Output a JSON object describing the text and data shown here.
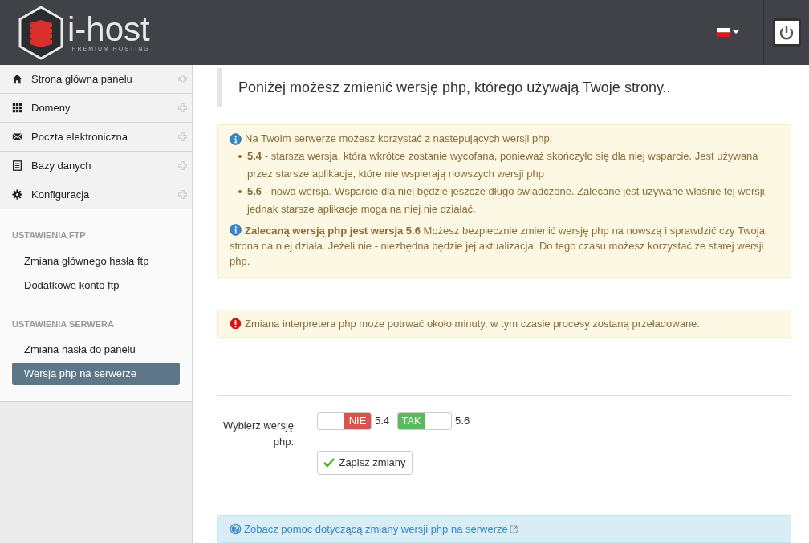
{
  "header": {
    "logo_text": "i-host",
    "logo_tagline": "PREMIUM HOSTING"
  },
  "sidebar": {
    "menu": [
      {
        "label": "Strona główna panelu"
      },
      {
        "label": "Domeny"
      },
      {
        "label": "Poczta elektroniczna"
      },
      {
        "label": "Bazy danych"
      },
      {
        "label": "Konfiguracja"
      }
    ],
    "sections": [
      {
        "heading": "USTAWIENIA FTP",
        "items": [
          {
            "label": "Zmiana głównego hasła ftp",
            "selected": false
          },
          {
            "label": "Dodatkowe konto ftp",
            "selected": false
          }
        ]
      },
      {
        "heading": "USTAWIENIA SERWERA",
        "items": [
          {
            "label": "Zmiana hasła do panelu",
            "selected": false
          },
          {
            "label": "Wersja php na serwerze",
            "selected": true
          }
        ]
      }
    ]
  },
  "page_title": "Poniżej możesz zmienić wersję php, którego używają Twoje strony..",
  "info": {
    "intro": "Na Twoim serwerze możesz korzystać z nastepujących wersji php:",
    "bullets": [
      "**5.4** - starsza wersja, która wkrótce zostanie wycofana, ponieważ skończyło się dla niej wsparcie. Jest używana przez starsze aplikacje, które nie wspierają nowszych wersji php",
      "**5.6** - nowa wersja. Wsparcie dla niej będzie jeszcze długo świadczone. Zalecane jest używane właśnie tej wersji, jednak starsze aplikacje moga na niej nie działać."
    ],
    "recommendation": "**Zalecaną wersją php jest wersja 5.6** Możesz bezpiecznie zmienić wersję php na nowszą i sprawdzić czy Twoja strona na niej działa. Jeżeli nie - niezbędna będzie jej aktualizacja. Do tego czasu możesz korzystać ze starej wersji php."
  },
  "warning": "Zmiana interpretera php może potrwać około minuty, w tym czasie procesy zostaną przeładowane.",
  "form": {
    "label": "Wybierz wersję php:",
    "toggles": [
      {
        "state_label": "NIE",
        "on": false,
        "version": "5.4"
      },
      {
        "state_label": "TAK",
        "on": true,
        "version": "5.6"
      }
    ],
    "save_button": "Zapisz zmiany"
  },
  "help_link": "Zobacz pomoc dotyczącą zmiany wersji php na serwerze"
}
